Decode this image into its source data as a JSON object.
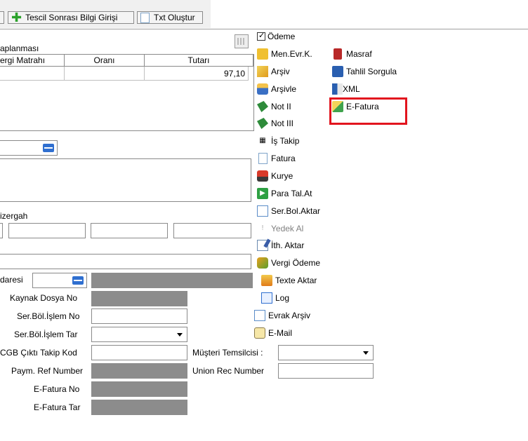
{
  "toolbar": {
    "tescil_label": "Tescil Sonrası Bilgi Girişi",
    "txt_label": "Txt Oluştur"
  },
  "grid": {
    "caption": "aplanması",
    "columns": [
      "ergi Matrahı",
      "Oranı",
      "Tutarı"
    ],
    "row": [
      "",
      "",
      "97,10"
    ]
  },
  "form": {
    "izergah_label": "izergah",
    "idaresi_label": "daresi",
    "kaynak_dosya_label": "Kaynak Dosya No",
    "ser_bol_islem_no_label": "Ser.Böl.İşlem No",
    "ser_bol_islem_tar_label": "Ser.Böl.İşlem Tar",
    "cgb_label": "CGB Çıktı Takip Kod",
    "paym_label": "Paym. Ref Number",
    "efatura_no_label": "E-Fatura No",
    "efatura_tar_label": "E-Fatura Tar",
    "musteri_label": "Müşteri Temsilcisi :",
    "union_label": "Union Rec Number"
  },
  "menu": {
    "col1": [
      {
        "label": "Ödeme",
        "icon": "checkbox-checked-icon"
      },
      {
        "label": "Men.Evr.K.",
        "icon": "folder-icon"
      },
      {
        "label": "Arşiv",
        "icon": "archive-icon"
      },
      {
        "label": "Arşivle",
        "icon": "archive-box-icon"
      },
      {
        "label": "Not II",
        "icon": "book-green-icon"
      },
      {
        "label": "Not III",
        "icon": "book-green-icon"
      },
      {
        "label": "İş Takip",
        "icon": "tracking-icon"
      },
      {
        "label": "Fatura",
        "icon": "document-icon"
      },
      {
        "label": "Kurye",
        "icon": "courier-icon"
      },
      {
        "label": "Para Tal.At",
        "icon": "arrow-green-icon"
      },
      {
        "label": "Ser.Bol.Aktar",
        "icon": "transfer-icon"
      },
      {
        "label": "Yedek Al",
        "icon": "backup-icon"
      },
      {
        "label": "İth. Aktar",
        "icon": "import-icon"
      },
      {
        "label": "Vergi Ödeme",
        "icon": "tax-payment-icon"
      },
      {
        "label": "Texte Aktar",
        "icon": "text-export-icon"
      },
      {
        "label": "Log",
        "icon": "log-icon"
      },
      {
        "label": "Evrak Arşiv",
        "icon": "document-archive-icon"
      },
      {
        "label": "E-Mail",
        "icon": "mail-icon"
      }
    ],
    "col2": [
      {
        "label": "Masraf",
        "icon": "expense-icon"
      },
      {
        "label": "Tahlil Sorgula",
        "icon": "query-icon"
      },
      {
        "label": "XML",
        "icon": "xml-icon"
      },
      {
        "label": "E-Fatura",
        "icon": "e-invoice-icon"
      }
    ]
  },
  "colors": {
    "highlight_border": "#e2141e",
    "disabled_field": "#8c8c8c"
  }
}
